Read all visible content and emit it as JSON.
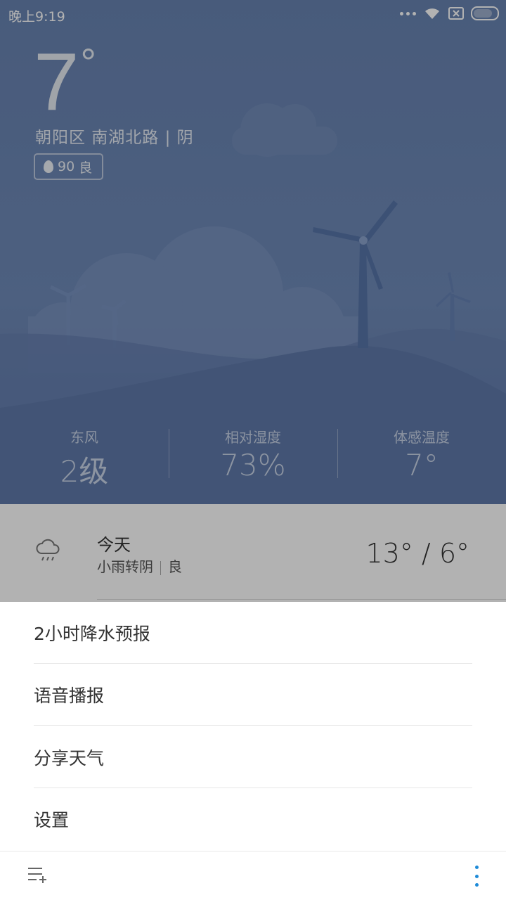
{
  "status_bar": {
    "time": "晚上9:19"
  },
  "weather": {
    "temperature": "7",
    "degree_symbol": "°",
    "location": "朝阳区  南湖北路 | 阴",
    "aqi_value": "90",
    "aqi_level": "良"
  },
  "stats": [
    {
      "label": "东风",
      "value": "2级"
    },
    {
      "label": "相对湿度",
      "value": "73%"
    },
    {
      "label": "体感温度",
      "value": "7°"
    }
  ],
  "today": {
    "day": "今天",
    "condition": "小雨转阴",
    "air": "良",
    "temp_range": "13° / 6°"
  },
  "menu": {
    "items": [
      {
        "label": "2小时降水预报"
      },
      {
        "label": "语音播报"
      },
      {
        "label": "分享天气"
      },
      {
        "label": "设置"
      }
    ]
  },
  "icons": {
    "rain": "cloud-rain-icon",
    "add_city": "add-city-icon",
    "more": "more-vertical-icon"
  },
  "colors": {
    "accent": "#1e8bd8",
    "hero_bg": "#6a83b3"
  }
}
